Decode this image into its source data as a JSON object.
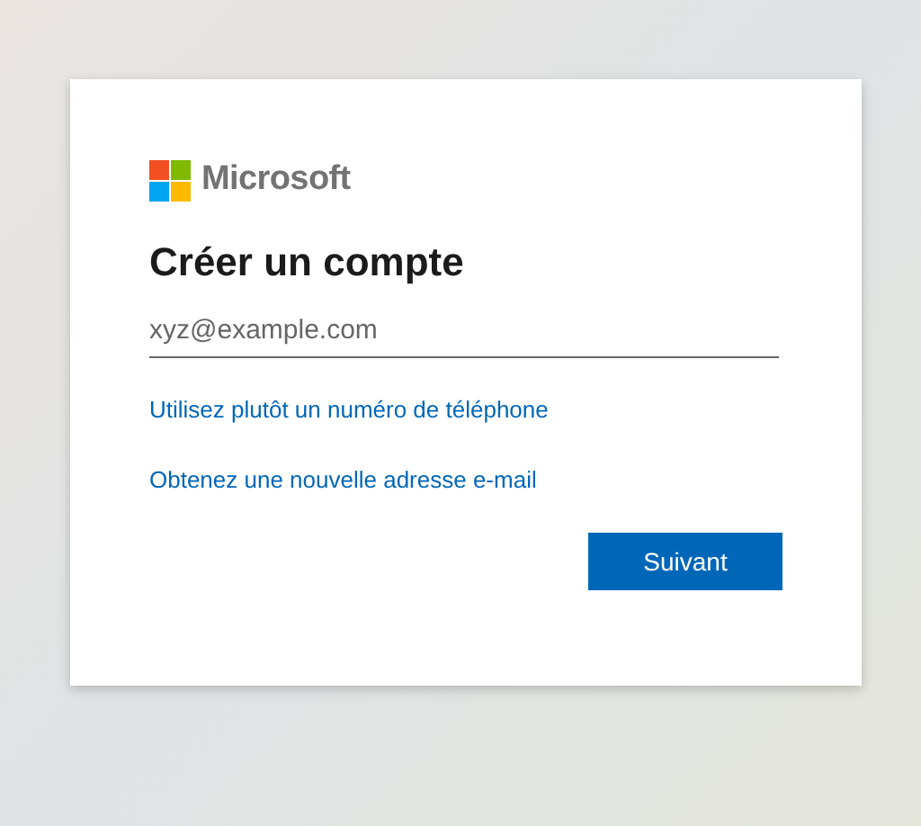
{
  "logo": {
    "text": "Microsoft"
  },
  "title": "Créer un compte",
  "email_field": {
    "placeholder": "xyz@example.com"
  },
  "links": [
    "Utilisez plutôt un numéro de téléphone",
    "Obtenez une nouvelle adresse e-mail"
  ],
  "next_button": {
    "label": "Suivant"
  }
}
